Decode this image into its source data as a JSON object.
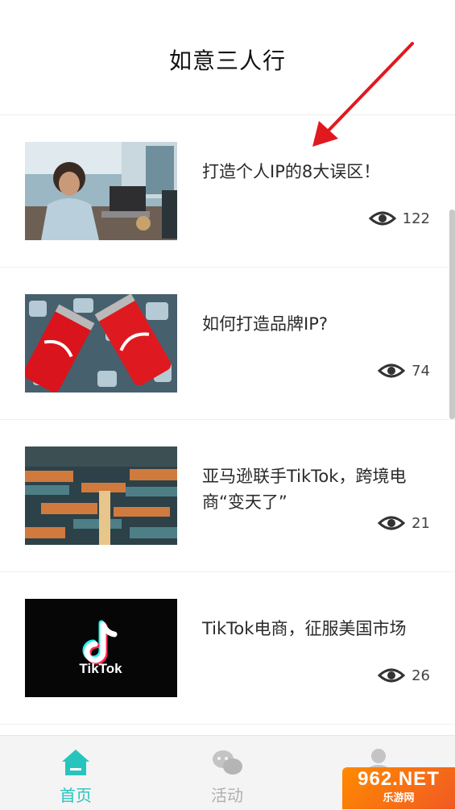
{
  "header": {
    "title": "如意三人行"
  },
  "articles": [
    {
      "title": "打造个人IP的8大误区！",
      "views": "122",
      "thumb": "person-laptop-photo"
    },
    {
      "title": "如何打造品牌IP?",
      "views": "74",
      "thumb": "coca-cola-cans-photo"
    },
    {
      "title": "亚马逊联手TikTok，跨境电商“变天了”",
      "views": "21",
      "thumb": "shipping-port-photo"
    },
    {
      "title": "TikTok电商，征服美国市场",
      "views": "26",
      "thumb": "tiktok-logo-image"
    }
  ],
  "thumb_text": {
    "tiktok": "TikTok"
  },
  "tabbar": {
    "tabs": [
      {
        "label": "首页",
        "icon": "home-icon",
        "active": true
      },
      {
        "label": "活动",
        "icon": "chat-bubbles-icon",
        "active": false
      },
      {
        "label": "",
        "icon": "person-icon",
        "active": false
      }
    ]
  },
  "watermark": {
    "main": "962.NET",
    "sub": "乐游网"
  },
  "colors": {
    "accent": "#27c4bd",
    "inactive": "#b0b0b0",
    "arrow": "#e0191e",
    "watermark": "#f57c1f"
  }
}
